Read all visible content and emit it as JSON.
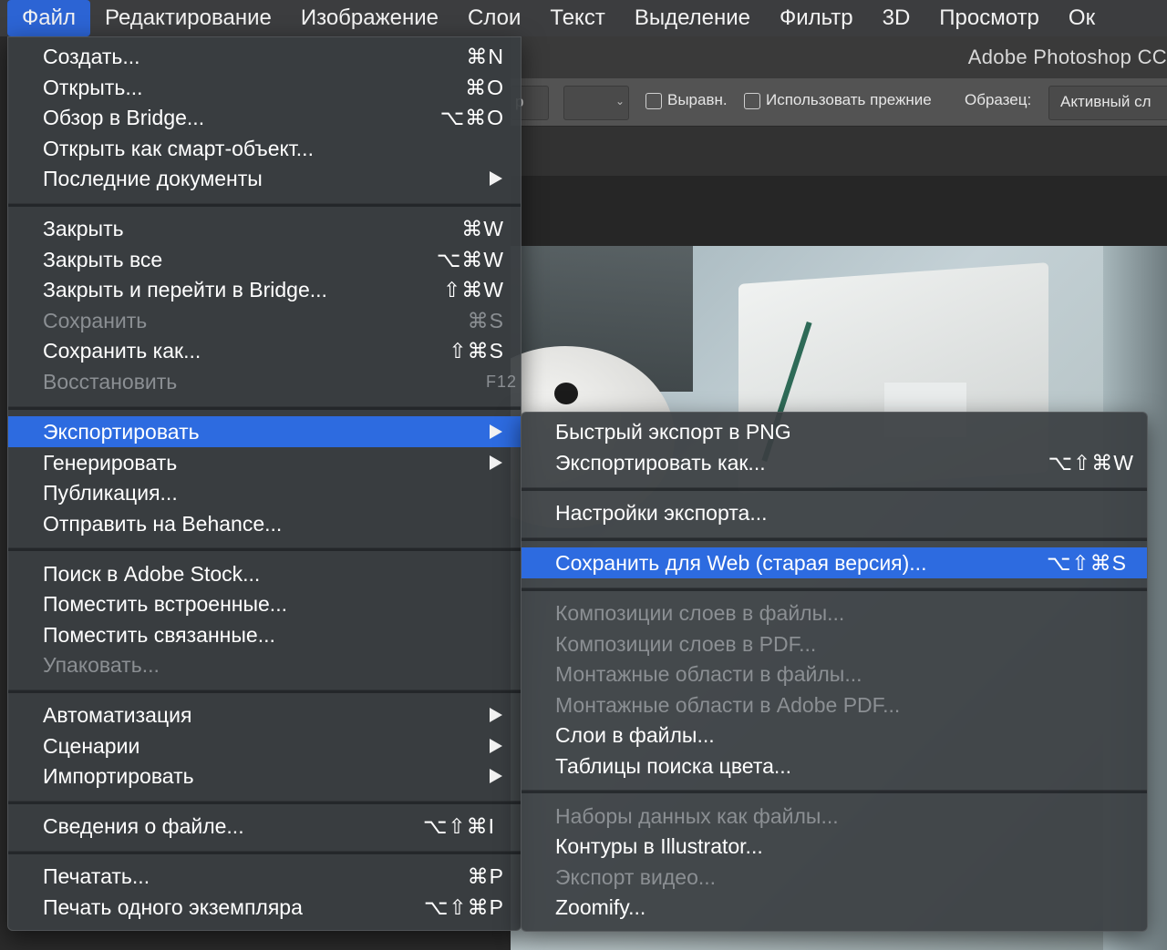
{
  "menubar": {
    "items": [
      "Файл",
      "Редактирование",
      "Изображение",
      "Слои",
      "Текст",
      "Выделение",
      "Фильтр",
      "3D",
      "Просмотр",
      "Ок"
    ]
  },
  "window": {
    "title": "Adobe Photoshop CC"
  },
  "options_bar": {
    "partial_text": "р",
    "align_label": "Выравн.",
    "use_legacy_label": "Использовать прежние",
    "sample_label": "Образец:",
    "sample_value": "Активный сл"
  },
  "file_menu": {
    "items": [
      {
        "label": "Создать...",
        "shortcut": "⌘N"
      },
      {
        "label": "Открыть...",
        "shortcut": "⌘O"
      },
      {
        "label": "Обзор в Bridge...",
        "shortcut": "⌥⌘O"
      },
      {
        "label": "Открыть как смарт-объект...",
        "shortcut": ""
      },
      {
        "label": "Последние документы",
        "shortcut": ""
      },
      {
        "label": "Закрыть",
        "shortcut": "⌘W"
      },
      {
        "label": "Закрыть все",
        "shortcut": "⌥⌘W"
      },
      {
        "label": "Закрыть и перейти в Bridge...",
        "shortcut": "⇧⌘W"
      },
      {
        "label": "Сохранить",
        "shortcut": "⌘S"
      },
      {
        "label": "Сохранить как...",
        "shortcut": "⇧⌘S"
      },
      {
        "label": "Восстановить",
        "shortcut": "F12"
      },
      {
        "label": "Экспортировать",
        "shortcut": ""
      },
      {
        "label": "Генерировать",
        "shortcut": ""
      },
      {
        "label": "Публикация...",
        "shortcut": ""
      },
      {
        "label": "Отправить на Behance...",
        "shortcut": ""
      },
      {
        "label": "Поиск в Adobe Stock...",
        "shortcut": ""
      },
      {
        "label": "Поместить встроенные...",
        "shortcut": ""
      },
      {
        "label": "Поместить связанные...",
        "shortcut": ""
      },
      {
        "label": "Упаковать...",
        "shortcut": ""
      },
      {
        "label": "Автоматизация",
        "shortcut": ""
      },
      {
        "label": "Сценарии",
        "shortcut": ""
      },
      {
        "label": "Импортировать",
        "shortcut": ""
      },
      {
        "label": "Сведения о файле...",
        "shortcut": "⌥⇧⌘I"
      },
      {
        "label": "Печатать...",
        "shortcut": "⌘P"
      },
      {
        "label": "Печать одного экземпляра",
        "shortcut": "⌥⇧⌘P"
      }
    ]
  },
  "export_menu": {
    "items": [
      {
        "label": "Быстрый экспорт в PNG",
        "shortcut": ""
      },
      {
        "label": "Экспортировать как...",
        "shortcut": "⌥⇧⌘W"
      },
      {
        "label": "Настройки экспорта...",
        "shortcut": ""
      },
      {
        "label": "Сохранить для Web (старая версия)...",
        "shortcut": "⌥⇧⌘S"
      },
      {
        "label": "Композиции слоев в файлы...",
        "shortcut": ""
      },
      {
        "label": "Композиции слоев в PDF...",
        "shortcut": ""
      },
      {
        "label": "Монтажные области в файлы...",
        "shortcut": ""
      },
      {
        "label": "Монтажные области в Adobe PDF...",
        "shortcut": ""
      },
      {
        "label": "Слои в файлы...",
        "shortcut": ""
      },
      {
        "label": "Таблицы поиска цвета...",
        "shortcut": ""
      },
      {
        "label": "Наборы данных как файлы...",
        "shortcut": ""
      },
      {
        "label": "Контуры в Illustrator...",
        "shortcut": ""
      },
      {
        "label": "Экспорт видео...",
        "shortcut": ""
      },
      {
        "label": "Zoomify...",
        "shortcut": ""
      }
    ]
  },
  "colors": {
    "highlight": "#2d6be0",
    "menubar_active": "#2c64d4",
    "disabled_text": "#8b8f93"
  }
}
